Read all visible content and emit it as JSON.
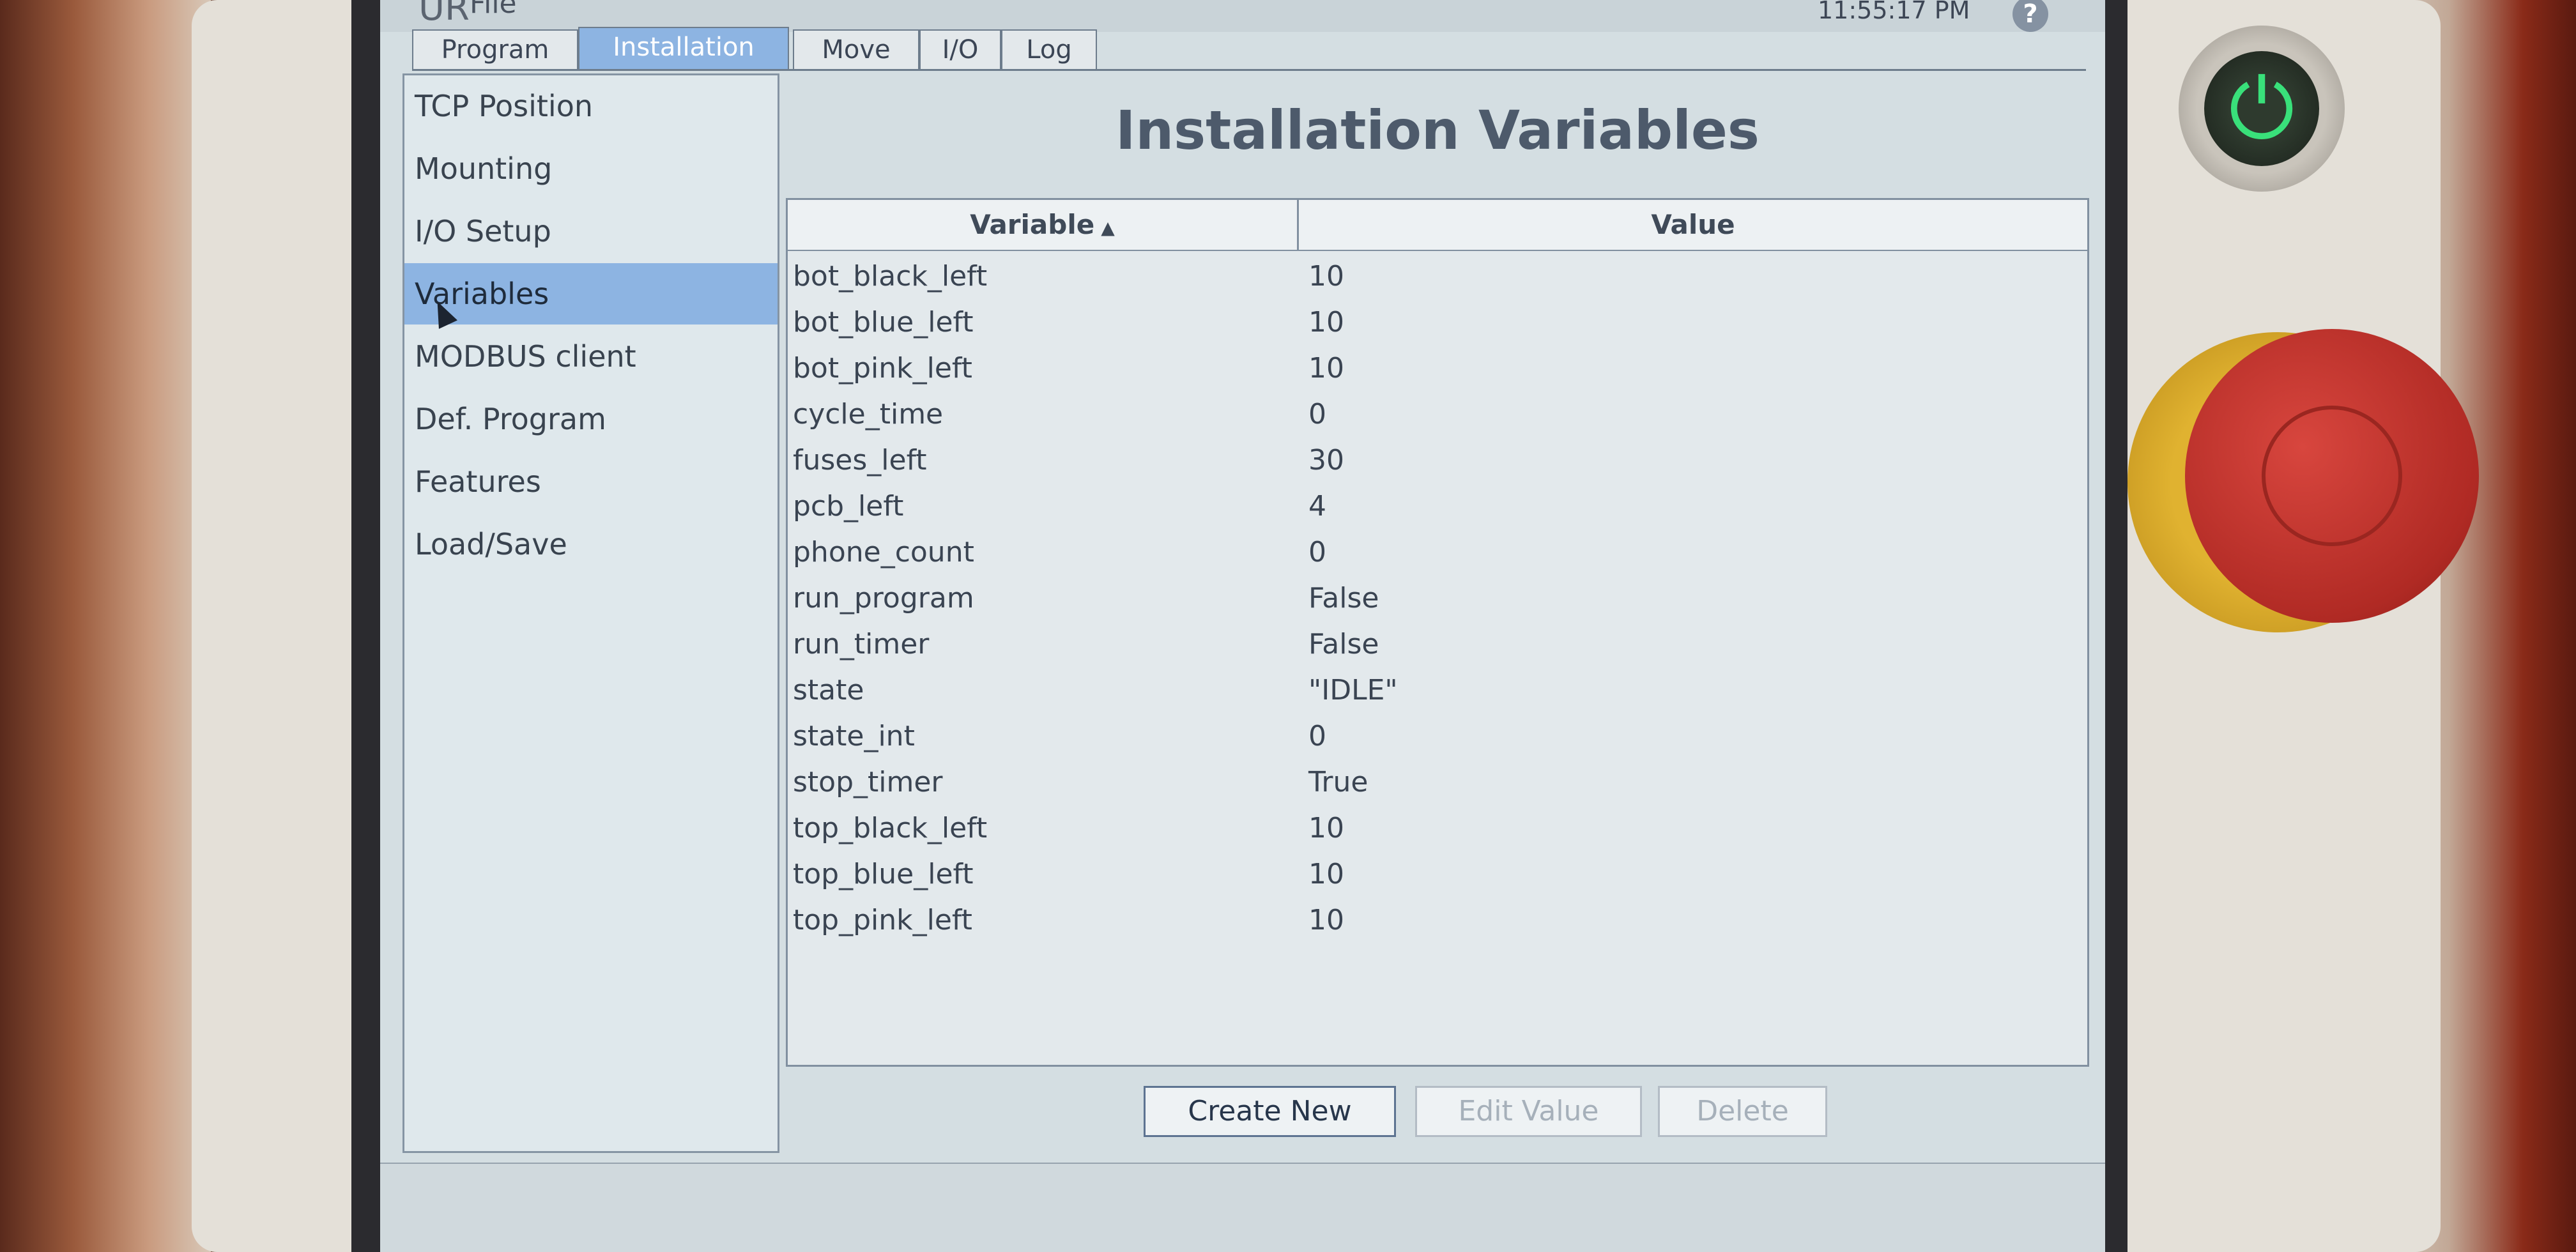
{
  "header": {
    "app_logo": "UR",
    "app_title": "File",
    "clock": "11:55:17 PM",
    "help_icon": "?"
  },
  "tabs": [
    {
      "label": "Program"
    },
    {
      "label": "Installation"
    },
    {
      "label": "Move"
    },
    {
      "label": "I/O"
    },
    {
      "label": "Log"
    }
  ],
  "sidebar": {
    "items": [
      {
        "label": "TCP Position"
      },
      {
        "label": "Mounting"
      },
      {
        "label": "I/O Setup"
      },
      {
        "label": "Variables"
      },
      {
        "label": "MODBUS client"
      },
      {
        "label": "Def. Program"
      },
      {
        "label": "Features"
      },
      {
        "label": "Load/Save"
      }
    ],
    "selected": "Variables"
  },
  "main": {
    "title": "Installation Variables",
    "table": {
      "columns": [
        "Variable",
        "Value"
      ],
      "sort_indicator": "▲",
      "rows": [
        {
          "variable": "bot_black_left",
          "value": "10"
        },
        {
          "variable": "bot_blue_left",
          "value": "10"
        },
        {
          "variable": "bot_pink_left",
          "value": "10"
        },
        {
          "variable": "cycle_time",
          "value": "0"
        },
        {
          "variable": "fuses_left",
          "value": "30"
        },
        {
          "variable": "pcb_left",
          "value": "4"
        },
        {
          "variable": "phone_count",
          "value": "0"
        },
        {
          "variable": "run_program",
          "value": "False"
        },
        {
          "variable": "run_timer",
          "value": "False"
        },
        {
          "variable": "state",
          "value": "\"IDLE\""
        },
        {
          "variable": "state_int",
          "value": "0"
        },
        {
          "variable": "stop_timer",
          "value": "True"
        },
        {
          "variable": "top_black_left",
          "value": "10"
        },
        {
          "variable": "top_blue_left",
          "value": "10"
        },
        {
          "variable": "top_pink_left",
          "value": "10"
        }
      ]
    },
    "buttons": {
      "create_new": "Create New",
      "edit_value": "Edit Value",
      "delete": "Delete"
    }
  },
  "hardware": {
    "power_icon": "⏻",
    "power_color": "#39e07a",
    "estop_color": "#c0322a"
  }
}
